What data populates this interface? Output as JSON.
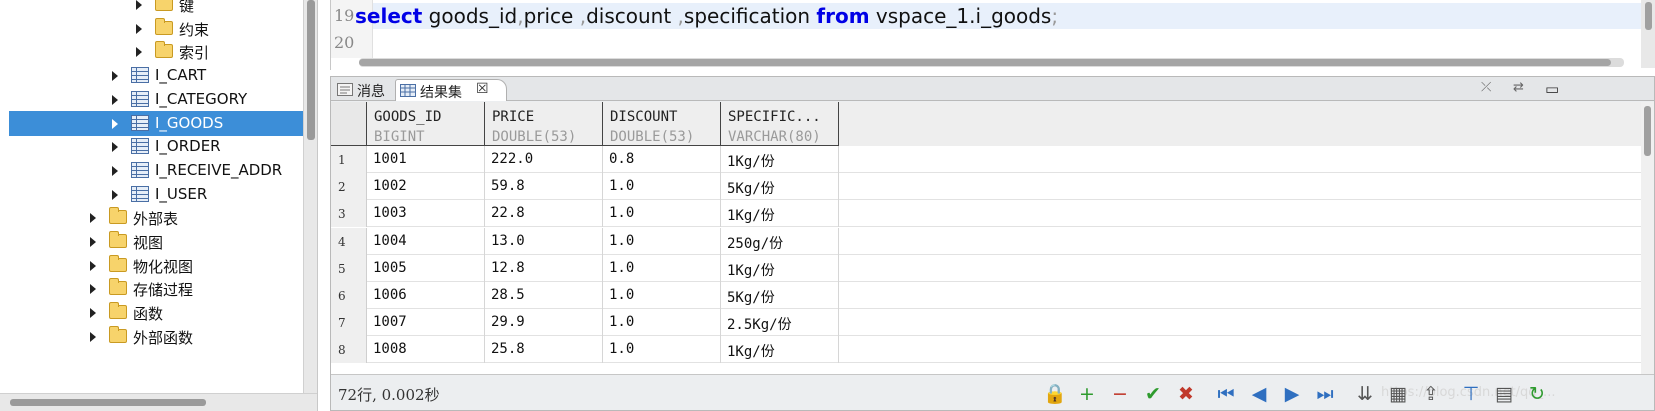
{
  "tree": {
    "items": [
      {
        "label": "键",
        "icon": "folder-icon",
        "level": 3
      },
      {
        "label": "约束",
        "icon": "folder-icon",
        "level": 3
      },
      {
        "label": "索引",
        "icon": "folder-icon",
        "level": 3
      },
      {
        "label": "I_CART",
        "icon": "table-icon",
        "level": 2
      },
      {
        "label": "I_CATEGORY",
        "icon": "table-icon",
        "level": 2
      },
      {
        "label": "I_GOODS",
        "icon": "table-icon",
        "level": 2,
        "selected": true
      },
      {
        "label": "I_ORDER",
        "icon": "table-icon",
        "level": 2
      },
      {
        "label": "I_RECEIVE_ADDR",
        "icon": "table-icon",
        "level": 2
      },
      {
        "label": "I_USER",
        "icon": "table-icon",
        "level": 2
      },
      {
        "label": "外部表",
        "icon": "folder-icon",
        "level": 1
      },
      {
        "label": "视图",
        "icon": "folder-icon",
        "level": 1
      },
      {
        "label": "物化视图",
        "icon": "folder-icon",
        "level": 1
      },
      {
        "label": "存储过程",
        "icon": "folder-icon",
        "level": 1
      },
      {
        "label": "函数",
        "icon": "folder-icon",
        "level": 1
      },
      {
        "label": "外部函数",
        "icon": "folder-icon",
        "level": 1
      }
    ]
  },
  "editor": {
    "line_numbers": [
      "19",
      "20"
    ],
    "query": {
      "kw_select": "select",
      "cols1": "goods_id",
      "sep1": ",",
      "cols2": "price ",
      "sep2": ",",
      "cols3": "discount ",
      "sep3": ",",
      "cols4": "specification ",
      "kw_from": "from",
      "table": "vspace_1.i_goods",
      "end": ";"
    }
  },
  "result_panel": {
    "tabs": [
      {
        "label": "消息",
        "icon": "message-icon"
      },
      {
        "label": "结果集",
        "icon": "result-grid-icon",
        "active": true
      }
    ],
    "tab_close": "☒",
    "columns": [
      {
        "name": "GOODS_ID",
        "type": "BIGINT"
      },
      {
        "name": "PRICE",
        "type": "DOUBLE(53)"
      },
      {
        "name": "DISCOUNT",
        "type": "DOUBLE(53)"
      },
      {
        "name": "SPECIFIC...",
        "type": "VARCHAR(80)"
      }
    ],
    "rows": [
      [
        "1",
        "1001",
        "222.0",
        "0.8",
        "1Kg/份"
      ],
      [
        "2",
        "1002",
        "59.8",
        "1.0",
        "5Kg/份"
      ],
      [
        "3",
        "1003",
        "22.8",
        "1.0",
        "1Kg/份"
      ],
      [
        "4",
        "1004",
        "13.0",
        "1.0",
        "250g/份"
      ],
      [
        "5",
        "1005",
        "12.8",
        "1.0",
        "1Kg/份"
      ],
      [
        "6",
        "1006",
        "28.5",
        "1.0",
        "5Kg/份"
      ],
      [
        "7",
        "1007",
        "29.9",
        "1.0",
        "2.5Kg/份"
      ],
      [
        "8",
        "1008",
        "25.8",
        "1.0",
        "1Kg/份"
      ]
    ],
    "status": "72行, 0.002秒",
    "watermark": "https://blog.csdn.net/qq_...",
    "toolbar_buttons": [
      {
        "name": "lock-icon",
        "glyph": "🔒",
        "color": "#c9a227"
      },
      {
        "name": "add-row-icon",
        "glyph": "+",
        "color": "#2e9b2e"
      },
      {
        "name": "delete-row-icon",
        "glyph": "−",
        "color": "#c0392b"
      },
      {
        "name": "commit-icon",
        "glyph": "✔",
        "color": "#2e9b2e"
      },
      {
        "name": "cancel-icon",
        "glyph": "✖",
        "color": "#c0392b"
      },
      {
        "name": "first-page-icon",
        "glyph": "⏮",
        "color": "#2f6fc0"
      },
      {
        "name": "prev-page-icon",
        "glyph": "◀",
        "color": "#2f6fc0"
      },
      {
        "name": "next-page-icon",
        "glyph": "▶",
        "color": "#2f6fc0"
      },
      {
        "name": "last-page-icon",
        "glyph": "⏭",
        "color": "#2f6fc0"
      },
      {
        "name": "fetch-all-icon",
        "glyph": "⇊",
        "color": "#555"
      },
      {
        "name": "grid-settings-icon",
        "glyph": "▦",
        "color": "#555"
      },
      {
        "name": "export-icon",
        "glyph": "⇪",
        "color": "#555"
      },
      {
        "name": "filter-icon",
        "glyph": "⊤",
        "color": "#2f6fc0"
      },
      {
        "name": "table-view-icon",
        "glyph": "▤",
        "color": "#555"
      },
      {
        "name": "refresh-icon",
        "glyph": "↻",
        "color": "#2e9b2e"
      }
    ]
  }
}
